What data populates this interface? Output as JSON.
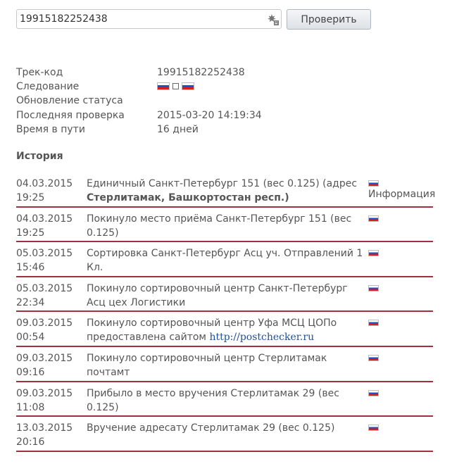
{
  "search": {
    "value": "19915182252438",
    "button_label": "Проверить",
    "icon": "keyboard-icon"
  },
  "info": {
    "rows": [
      {
        "label": "Трек-код",
        "value": "19915182252438"
      },
      {
        "label": "Следование",
        "route": {
          "from_flag": "russia-flag-icon",
          "to_flag": "russia-flag-icon"
        }
      },
      {
        "label": "Обновление статуса",
        "value": ""
      },
      {
        "label": "Последняя проверка",
        "value": "2015-03-20 14:19:34"
      },
      {
        "label": "Время в пути",
        "value": "16 дней"
      }
    ]
  },
  "history": {
    "title": "История",
    "rows": [
      {
        "date": "04.03.2015",
        "time": "19:25",
        "text": "Единичный Санкт-Петербург 151 (вес 0.125) (адрес ",
        "bold": "Стерлитамак, Башкортостан респ.)",
        "flag": "russia-flag-icon",
        "info": "Информация"
      },
      {
        "date": "04.03.2015",
        "time": "19:25",
        "text": "Покинуло место приёма Санкт-Петербург 151 (вес 0.125)",
        "flag": "russia-flag-icon"
      },
      {
        "date": "05.03.2015",
        "time": "15:46",
        "text": "Сортировка Санкт-Петербург Асц уч. Отправлений 1 Кл.",
        "flag": "russia-flag-icon"
      },
      {
        "date": "05.03.2015",
        "time": "22:34",
        "text": "Покинуло сортировочный центр Санкт-Петербург Асц цех Логистики",
        "flag": "russia-flag-icon"
      },
      {
        "date": "09.03.2015",
        "time": "00:54",
        "text": "Покинуло сортировочный центр Уфа МСЦ ЦОПо предоставлена сайтом ",
        "link": "http://postchecker.ru",
        "flag": "russia-flag-icon"
      },
      {
        "date": "09.03.2015",
        "time": "09:16",
        "text": "Покинуло сортировочный центр Стерлитамак почтамт",
        "flag": "russia-flag-icon"
      },
      {
        "date": "09.03.2015",
        "time": "11:08",
        "text": "Прибыло в место вручения Стерлитамак 29 (вес 0.125)",
        "flag": "russia-flag-icon"
      },
      {
        "date": "13.03.2015",
        "time": "20:16",
        "text": "Вручение адресату Стерлитамак 29 (вес 0.125)",
        "flag": "russia-flag-icon"
      }
    ]
  }
}
